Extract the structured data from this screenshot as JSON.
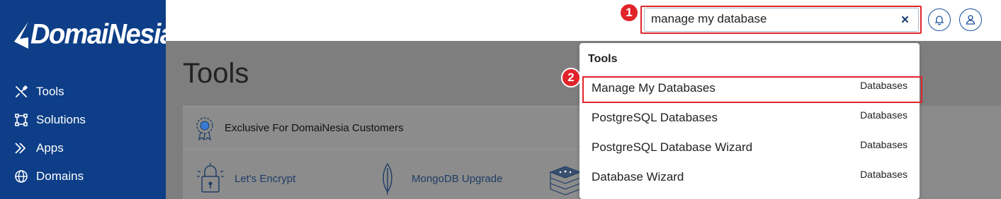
{
  "sidebar": {
    "logo": "DomaiNesia",
    "items": [
      {
        "label": "Tools",
        "icon": "tools-icon"
      },
      {
        "label": "Solutions",
        "icon": "solutions-icon"
      },
      {
        "label": "Apps",
        "icon": "apps-icon"
      },
      {
        "label": "Domains",
        "icon": "globe-icon"
      }
    ]
  },
  "search": {
    "value": "manage my database",
    "clear_label": "×"
  },
  "badges": {
    "step1": "1",
    "step2": "2"
  },
  "main": {
    "title": "Tools",
    "exclusive_label": "Exclusive For DomaiNesia Customers",
    "tools": [
      "Let's Encrypt",
      "MongoDB Upgrade"
    ]
  },
  "dropdown": {
    "heading": "Tools",
    "results": [
      {
        "name": "Manage My Databases",
        "category": "Databases"
      },
      {
        "name": "PostgreSQL Databases",
        "category": "Databases"
      },
      {
        "name": "PostgreSQL Database Wizard",
        "category": "Databases"
      },
      {
        "name": "Database Wizard",
        "category": "Databases"
      }
    ]
  },
  "colors": {
    "sidebar": "#0d3e87",
    "highlight": "#e0242a",
    "overlay": "#7e7e7e"
  }
}
